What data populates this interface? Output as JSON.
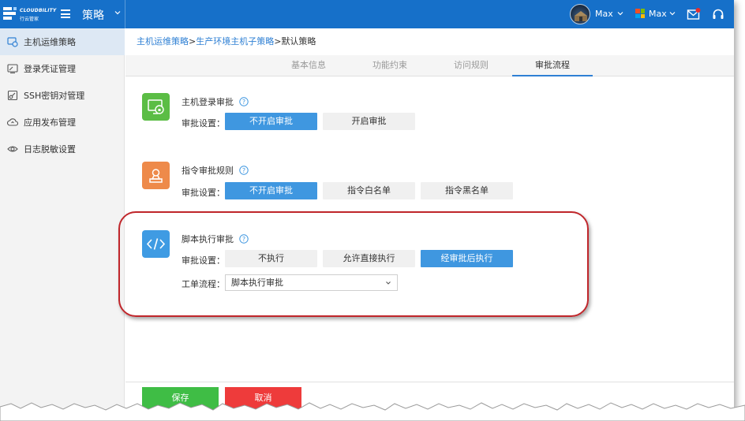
{
  "header": {
    "brand": "CLOUDBILITY",
    "brand_sub": "行云管家",
    "app_title": "策略",
    "user1": "Max",
    "user2": "Max"
  },
  "sidebar": {
    "items": [
      {
        "label": "主机运维策略",
        "icon": "host-policy-icon",
        "active": true
      },
      {
        "label": "登录凭证管理",
        "icon": "credential-icon",
        "active": false
      },
      {
        "label": "SSH密钥对管理",
        "icon": "ssh-key-icon",
        "active": false
      },
      {
        "label": "应用发布管理",
        "icon": "cloud-upload-icon",
        "active": false
      },
      {
        "label": "日志脱敏设置",
        "icon": "eye-icon",
        "active": false
      }
    ]
  },
  "breadcrumb": {
    "level1": "主机运维策略",
    "sep1": ">",
    "level2": "生产环境主机子策略",
    "sep2": ">",
    "current": "默认策略"
  },
  "tabs": [
    {
      "label": "基本信息",
      "active": false
    },
    {
      "label": "功能约束",
      "active": false
    },
    {
      "label": "访问规则",
      "active": false
    },
    {
      "label": "审批流程",
      "active": true
    }
  ],
  "sections": {
    "login_approval": {
      "title": "主机登录审批",
      "setting_label": "审批设置：",
      "options": [
        "不开启审批",
        "开启审批"
      ],
      "selected": "不开启审批",
      "color": "#5bbd45"
    },
    "command_approval": {
      "title": "指令审批规则",
      "setting_label": "审批设置：",
      "options": [
        "不开启审批",
        "指令白名单",
        "指令黑名单"
      ],
      "selected": "不开启审批",
      "color": "#ee8a4a"
    },
    "script_approval": {
      "title": "脚本执行审批",
      "setting_label": "审批设置：",
      "options": [
        "不执行",
        "允许直接执行",
        "经审批后执行"
      ],
      "selected": "经审批后执行",
      "workflow_label": "工单流程：",
      "workflow_value": "脚本执行审批",
      "color": "#3f9be3"
    }
  },
  "footer": {
    "save": "保存",
    "cancel": "取消"
  },
  "colors": {
    "topbar": "#1670c9",
    "selected_option": "#3f97e0",
    "highlight_border": "#c0262b",
    "save_button": "#3fbd45",
    "cancel_button": "#ee3b3b"
  }
}
